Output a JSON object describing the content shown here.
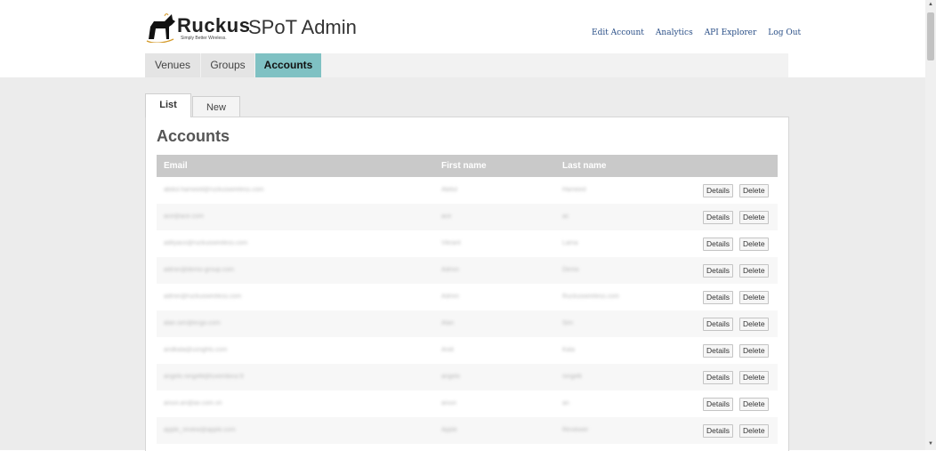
{
  "brand": {
    "word": "Ruckus",
    "tagline": "Simply Better Wireless."
  },
  "app_title": "SPoT Admin",
  "top_links": [
    "Edit Account",
    "Analytics",
    "API Explorer",
    "Log Out"
  ],
  "nav_tabs": [
    "Venues",
    "Groups",
    "Accounts"
  ],
  "sub_tabs": [
    "List",
    "New"
  ],
  "panel_title": "Accounts",
  "columns": {
    "email": "Email",
    "first_name": "First name",
    "last_name": "Last name"
  },
  "actions": {
    "details": "Details",
    "delete": "Delete"
  },
  "colors": {
    "accent": "#7fc1c3",
    "header_row": "#c9c9c9",
    "link": "#2a4f87"
  },
  "rows": [
    {
      "email": "abdul.hameed@ruckuswireless.com",
      "first": "Abdul",
      "last": "Hameed"
    },
    {
      "email": "ace@ace.com",
      "first": "ace",
      "last": "ac"
    },
    {
      "email": "adityaco@ruckuswireless.com",
      "first": "Vikrant",
      "last": "Lama"
    },
    {
      "email": "admin@demo-group.com",
      "first": "Admin",
      "last": "Demo"
    },
    {
      "email": "admin@ruckuswireless.com",
      "first": "Admin",
      "last": "Ruckuswireless.com"
    },
    {
      "email": "alan.sim@ecgo.com",
      "first": "Alan",
      "last": "Sim"
    },
    {
      "email": "andkala@usrights.com",
      "first": "Andi",
      "last": "Kala"
    },
    {
      "email": "angelo.ningelli@luxembour.lt",
      "first": "angelo",
      "last": "ningelli"
    },
    {
      "email": "anuvi.an@ax.com.vn",
      "first": "anuvi",
      "last": "an"
    },
    {
      "email": "apple_review@apple.com",
      "first": "Apple",
      "last": "Reviewer"
    }
  ]
}
